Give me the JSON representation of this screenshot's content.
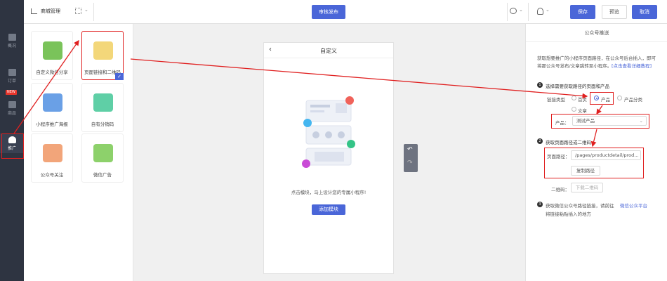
{
  "topbar": {
    "app_title": "商城管理",
    "publish_label": "审核发布",
    "save_label": "保存",
    "preview_label": "预览",
    "cancel_label": "取消"
  },
  "leftbar": {
    "items": [
      {
        "label": "概况"
      },
      {
        "label": "订单"
      },
      {
        "label": "商品"
      },
      {
        "label": "推广",
        "active": true
      }
    ],
    "new_badge": "NEW"
  },
  "panel": {
    "cards": [
      {
        "label": "自定义微信分享",
        "icon": "wechat-share-icon"
      },
      {
        "label": "页面链接和二维码",
        "icon": "qrcode-link-icon",
        "selected": true
      },
      {
        "label": "小程序推广海报",
        "icon": "megaphone-icon"
      },
      {
        "label": "自有分销码",
        "icon": "clipboard-icon"
      },
      {
        "label": "公众号关注",
        "icon": "heart-card-icon"
      },
      {
        "label": "微信广告",
        "icon": "search-ad-icon"
      }
    ]
  },
  "canvas": {
    "phone_title": "自定义",
    "hint": "点击模块，马上设计您的专属小程序!",
    "add_module_label": "添加模块"
  },
  "right": {
    "header": "公众号推送",
    "intro_line1": "获取想要推广的小程序页面路径，在公众号后台插入，即可",
    "intro_line2": "将那公众号发布/文章跳转至小程序。",
    "intro_link": "[点击查看详细教程]",
    "step1": "选择需要获取路径的页面和产品",
    "link_type_label": "链接类型",
    "radio_home": "首页",
    "radio_product": "产品",
    "radio_category": "产品分类",
    "radio_article": "文章",
    "product_label": "产品：",
    "product_value": "测试产品",
    "step2": "获取页面路径或二维码",
    "page_path_label": "页面路径：",
    "page_path_value": "/pages/productdetail/prod...",
    "copy_path_label": "复制路径",
    "qrcode_label": "二维码：",
    "download_qrcode_label": "下载二维码",
    "step3_line1": "获取微信公众号路径链接，请前往",
    "step3_link": "微信公众平台",
    "step3_line2": "将链接粘贴插入的地方"
  },
  "colors": {
    "accent": "#4a66d8",
    "sidebar": "#2e3441",
    "annotation": "#e02020",
    "new_badge": "#e8352c"
  }
}
